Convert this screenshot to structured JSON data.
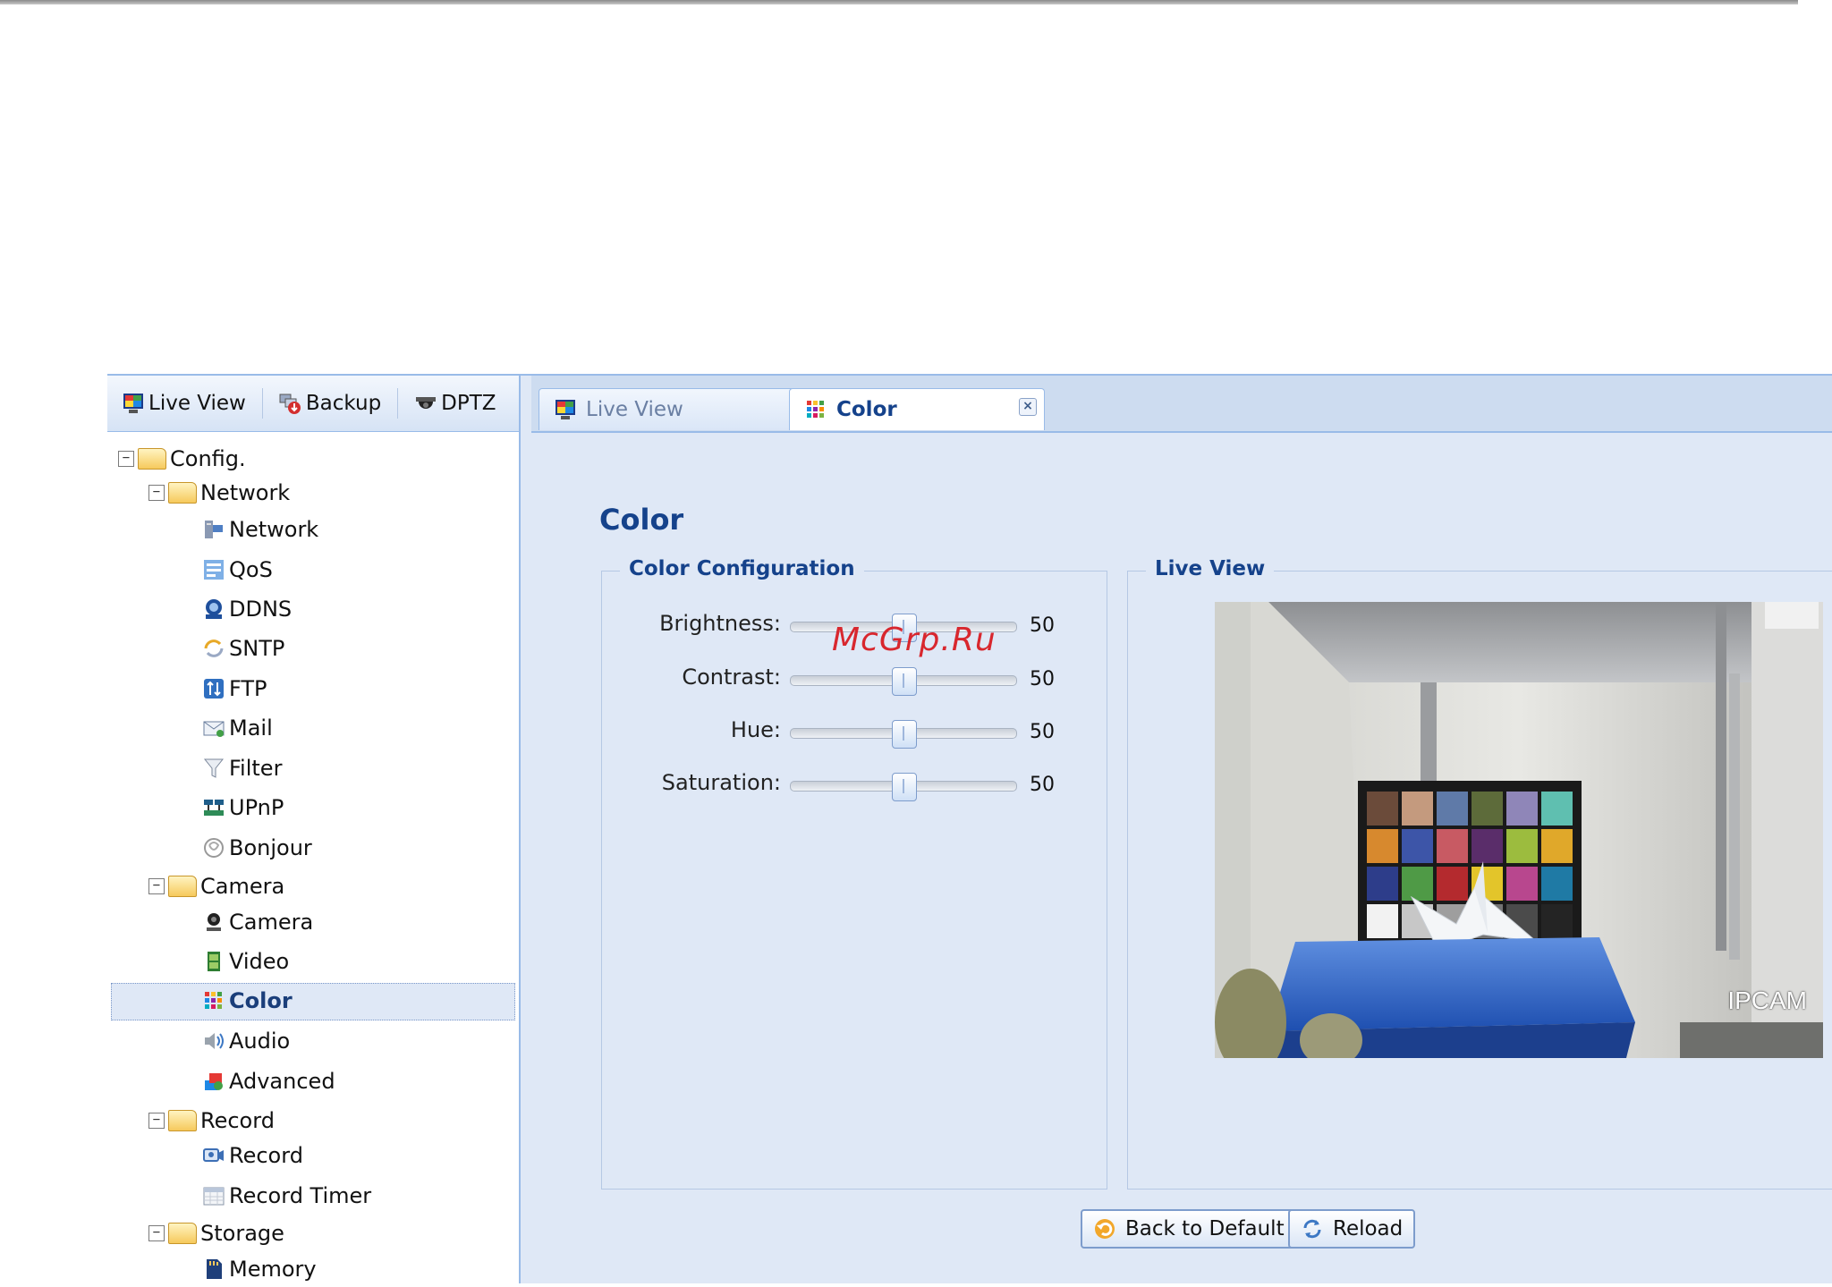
{
  "left_toolbar": {
    "live_view": "Live View",
    "backup": "Backup",
    "dptz": "DPTZ"
  },
  "tree": {
    "config": "Config.",
    "network_group": "Network",
    "network": "Network",
    "qos": "QoS",
    "ddns": "DDNS",
    "sntp": "SNTP",
    "ftp": "FTP",
    "mail": "Mail",
    "filter": "Filter",
    "upnp": "UPnP",
    "bonjour": "Bonjour",
    "camera_group": "Camera",
    "camera": "Camera",
    "video": "Video",
    "color": "Color",
    "audio": "Audio",
    "advanced": "Advanced",
    "record_group": "Record",
    "record": "Record",
    "record_timer": "Record Timer",
    "storage_group": "Storage",
    "memory": "Memory"
  },
  "tabs": [
    {
      "label": "Live View"
    },
    {
      "label": "Color"
    }
  ],
  "page_title": "Color",
  "color_config": {
    "legend": "Color Configuration",
    "sliders": [
      {
        "label": "Brightness:",
        "value": "50",
        "fraction": 0.5
      },
      {
        "label": "Contrast:",
        "value": "50",
        "fraction": 0.5
      },
      {
        "label": "Hue:",
        "value": "50",
        "fraction": 0.5
      },
      {
        "label": "Saturation:",
        "value": "50",
        "fraction": 0.5
      }
    ]
  },
  "live_view": {
    "legend": "Live View",
    "overlay": "IPCAM"
  },
  "watermark": "McGrp.Ru",
  "buttons": {
    "back_to_default": "Back to Default",
    "reload": "Reload"
  },
  "colors": {
    "accent": "#15428b",
    "panel_bg": "#dfe8f6",
    "border": "#99bbe8",
    "watermark": "#d8272e"
  },
  "icons": {
    "live_view": "monitor-icon",
    "backup": "backup-icon",
    "dptz": "dome-camera-icon",
    "color": "color-grid-icon",
    "close": "close-icon"
  }
}
